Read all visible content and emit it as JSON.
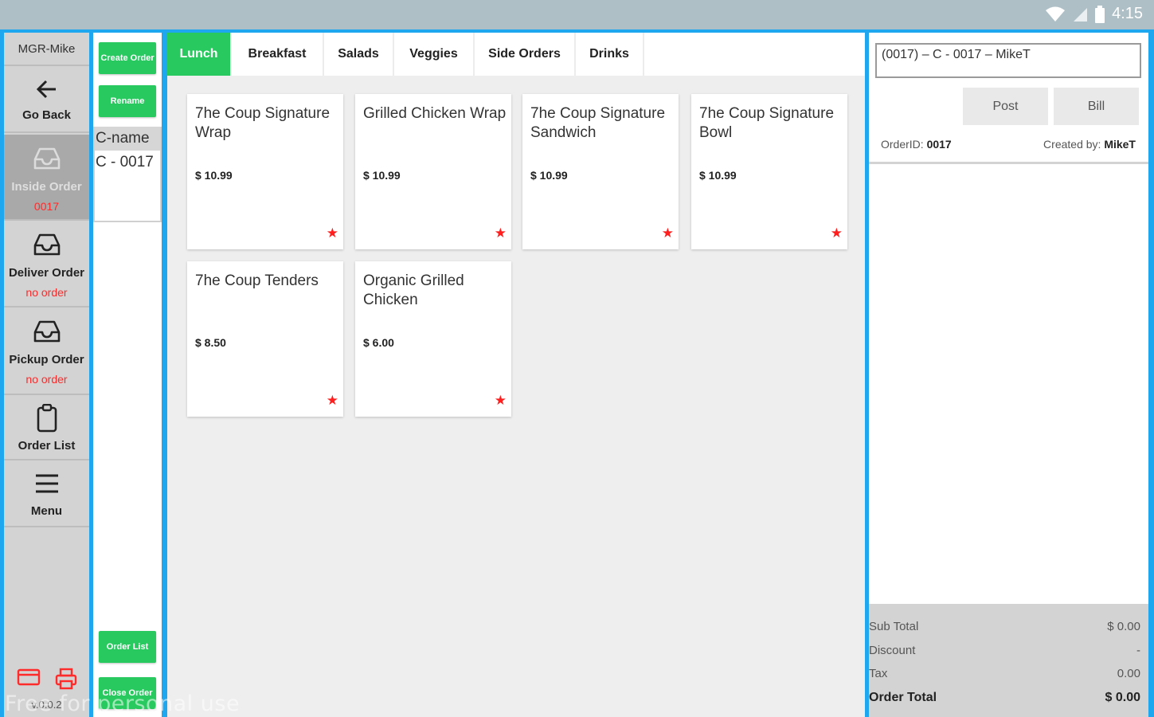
{
  "status_bar": {
    "time": "4:15",
    "icons": [
      "wifi-icon",
      "signal-icon",
      "battery-icon"
    ]
  },
  "nav": {
    "user": "MGR-Mike",
    "items": [
      {
        "icon": "arrow-left-icon",
        "label": "Go Back",
        "sub": ""
      },
      {
        "icon": "inbox-icon",
        "label": "Inside Order",
        "sub": "0017"
      },
      {
        "icon": "inbox-icon",
        "label": "Deliver Order",
        "sub": "no order"
      },
      {
        "icon": "inbox-icon",
        "label": "Pickup Order",
        "sub": "no order"
      },
      {
        "icon": "clipboard-icon",
        "label": "Order List",
        "sub": ""
      },
      {
        "icon": "menu-icon",
        "label": "Menu",
        "sub": ""
      }
    ],
    "bottom_icons": [
      "card-icon",
      "printer-icon"
    ],
    "version": "v.0.0.2"
  },
  "orders_column": {
    "create_order": "Create Order",
    "rename": "Rename",
    "ticket_header": "C-name",
    "ticket_value": "C - 0017",
    "order_list": "Order List",
    "close_order": "Close Order"
  },
  "tabs": [
    {
      "label": "Lunch",
      "active": true
    },
    {
      "label": "Breakfast",
      "active": false
    },
    {
      "label": "Salads",
      "active": false
    },
    {
      "label": "Veggies",
      "active": false
    },
    {
      "label": "Side Orders",
      "active": false
    },
    {
      "label": "Drinks",
      "active": false
    }
  ],
  "menu_items": [
    {
      "name": "7he Coup Signature Wrap",
      "price": "$ 10.99",
      "star": "★"
    },
    {
      "name": "Grilled Chicken Wrap",
      "price": "$ 10.99",
      "star": "★"
    },
    {
      "name": "7he Coup Signature Sandwich",
      "price": "$ 10.99",
      "star": "★"
    },
    {
      "name": "7he Coup Signature Bowl",
      "price": "$ 10.99",
      "star": "★"
    },
    {
      "name": "7he Coup Tenders",
      "price": "$ 8.50",
      "star": "★"
    },
    {
      "name": "Organic Grilled Chicken",
      "price": "$ 6.00",
      "star": "★"
    }
  ],
  "order_panel": {
    "title": "(0017) –  C - 0017 –  MikeT",
    "post": "Post",
    "bill": "Bill",
    "order_id_label": "OrderID:",
    "order_id": "0017",
    "created_by_label": "Created by:",
    "created_by": "MikeT",
    "totals": {
      "subtotal_label": "Sub Total",
      "subtotal": "$ 0.00",
      "discount_label": "Discount",
      "discount": "-",
      "tax_label": "Tax",
      "tax": "0.00",
      "order_total_label": "Order Total",
      "order_total": "$ 0.00"
    }
  },
  "watermark": "Free for personal use",
  "colors": {
    "accent_green": "#28c95f",
    "frame_blue": "#1ea7ee",
    "status_red": "#ff2a2a"
  }
}
